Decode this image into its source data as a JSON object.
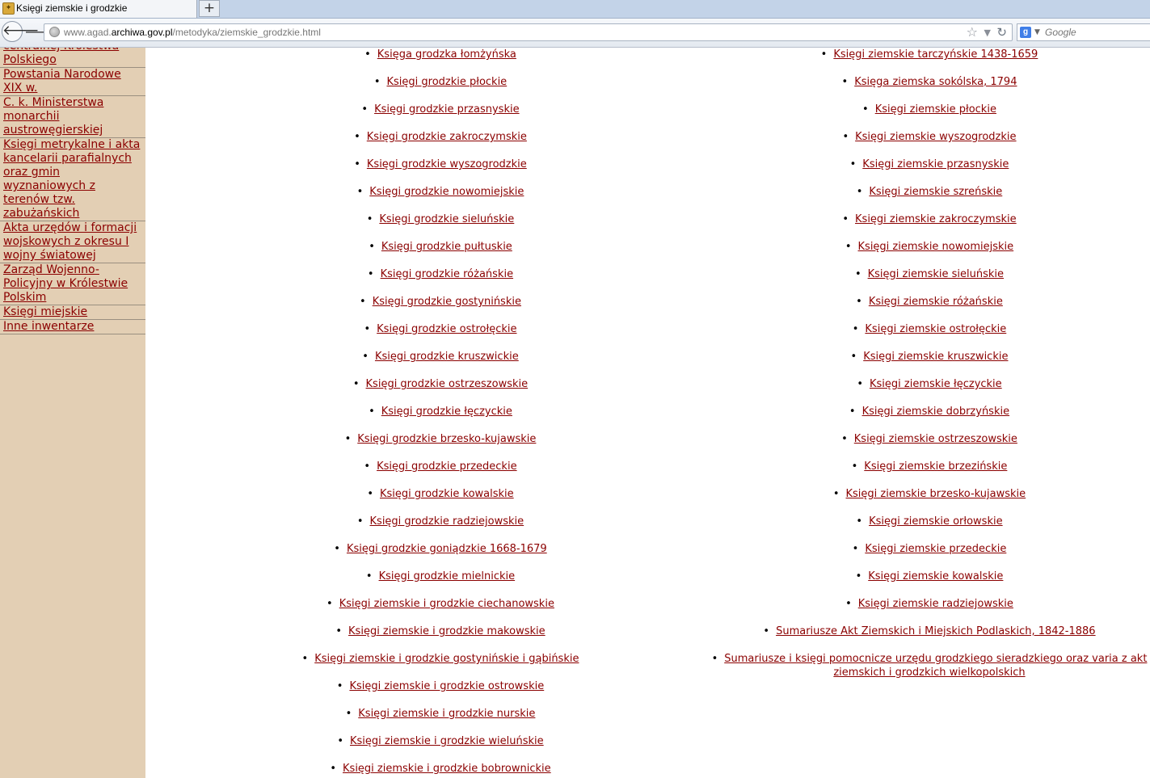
{
  "browser": {
    "tab_title": "Księgi ziemskie i grodzkie",
    "newtab_label": "+",
    "url_prefix": "www.agad.",
    "url_domain": "archiwa.gov.pl",
    "url_path": "/metodyka/ziemskie_grodzkie.html",
    "search_placeholder": "Google",
    "icons": {
      "back": "back-arrow-icon",
      "forward": "forward-arrow-icon",
      "site": "globe-icon",
      "bookmark": "star-icon",
      "reload": "reload-icon",
      "search_engine": "google-icon"
    }
  },
  "colors": {
    "link": "#8b0000",
    "sidebar_bg": "#e3cfb4",
    "tabstrip_bg": "#c3d3e8"
  },
  "sidebar": {
    "items": [
      "centralnej Królestwa Polskiego",
      "Powstania Narodowe XIX w.",
      "C. k. Ministerstwa monarchii austrowęgierskiej",
      "Księgi metrykalne i akta kancelarii parafialnych oraz gmin wyznaniowych z terenów tzw. zabużańskich",
      "Akta urzędów i formacji wojskowych z okresu I wojny światowej",
      "Zarząd Wojenno-Policyjny w Królestwie Polskim",
      "Księgi miejskie",
      "Inne inwentarze"
    ]
  },
  "main": {
    "bullet": "•",
    "left_links": [
      "Księga grodzka łomżyńska",
      "Księgi grodzkie płockie",
      "Księgi grodzkie przasnyskie",
      "Księgi grodzkie zakroczymskie",
      "Księgi grodzkie wyszogrodzkie",
      "Księgi grodzkie nowomiejskie",
      "Księgi grodzkie sieluńskie",
      "Księgi grodzkie pułtuskie",
      "Księgi grodzkie różańskie",
      "Księgi grodzkie gostynińskie",
      "Księgi grodzkie ostrołęckie",
      "Księgi grodzkie kruszwickie",
      "Księgi grodzkie ostrzeszowskie",
      "Księgi grodzkie łęczyckie",
      "Księgi grodzkie brzesko-kujawskie",
      "Księgi grodzkie przedeckie",
      "Księgi grodzkie kowalskie",
      "Księgi grodzkie radziejowskie",
      "Księgi grodzkie goniądzkie 1668-1679",
      "Księgi grodzkie mielnickie",
      "Księgi ziemskie i grodzkie ciechanowskie",
      "Księgi ziemskie i grodzkie makowskie",
      "Księgi ziemskie i grodzkie gostynińskie i gąbińskie",
      "Księgi ziemskie i grodzkie ostrowskie",
      "Księgi ziemskie i grodzkie nurskie",
      "Księgi ziemskie i grodzkie wieluńskie",
      "Księgi ziemskie i grodzkie bobrownickie"
    ],
    "right_links": [
      "Księgi ziemskie tarczyńskie 1438-1659",
      "Księga ziemska sokólska, 1794",
      "Księgi ziemskie płockie",
      "Księgi ziemskie wyszogrodzkie",
      "Księgi ziemskie przasnyskie",
      "Księgi ziemskie szreńskie",
      "Księgi ziemskie zakroczymskie",
      "Księgi ziemskie nowomiejskie",
      "Księgi ziemskie sieluńskie",
      "Księgi ziemskie różańskie",
      "Księgi ziemskie ostrołęckie",
      "Księgi ziemskie kruszwickie",
      "Księgi ziemskie łęczyckie",
      "Księgi ziemskie dobrzyńskie",
      "Księgi ziemskie ostrzeszowskie",
      "Księgi ziemskie brzezińskie",
      "Księgi ziemskie brzesko-kujawskie",
      "Księgi ziemskie orłowskie",
      "Księgi ziemskie przedeckie",
      "Księgi ziemskie kowalskie",
      "Księgi ziemskie radziejowskie",
      "Sumariusze Akt Ziemskich i Miejskich Podlaskich, 1842-1886",
      "Sumariusze i księgi pomocnicze urzędu grodzkiego sieradzkiego oraz varia z akt ziemskich i grodzkich wielkopolskich"
    ]
  }
}
